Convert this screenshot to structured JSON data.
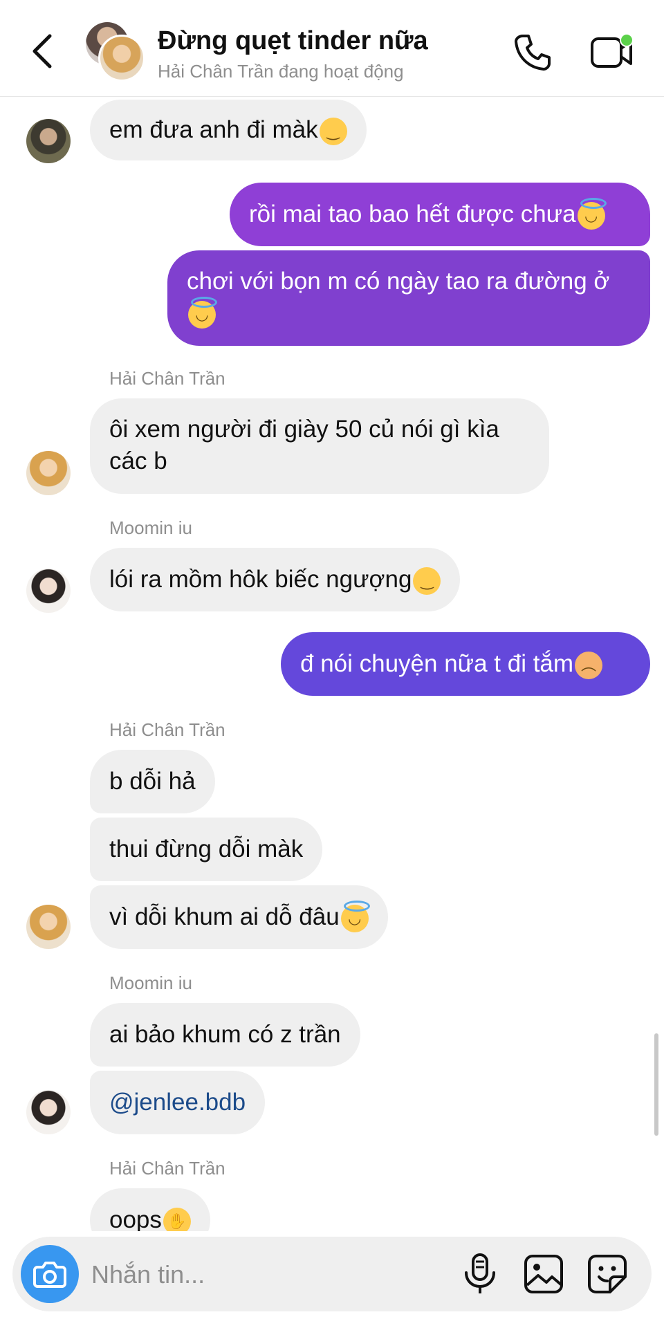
{
  "header": {
    "title": "Đừng quẹt tinder nữa",
    "subtitle": "Hải Chân Trần đang hoạt động",
    "icons": [
      "chevron-left-icon",
      "phone-icon",
      "video-call-icon"
    ]
  },
  "messages": [
    {
      "direction": "in",
      "sender": "",
      "text": "em đưa anh đi màk",
      "emoji": "😞"
    },
    {
      "direction": "out",
      "text": "rồi mai tao bao hết được chưa",
      "emoji": "😇"
    },
    {
      "direction": "out",
      "text": "chơi với bọn m có ngày tao ra đường ở",
      "emoji": "😇"
    },
    {
      "direction": "in",
      "sender": "Hải Chân Trần",
      "text_line1": "ôi xem người đi giày 50 củ nói gì kìa",
      "text_line2": "các b"
    },
    {
      "direction": "in",
      "sender": "Moomin iu",
      "text": "lói ra mồm hôk biếc ngượng",
      "emoji": "😞"
    },
    {
      "direction": "out",
      "text": "đ nói chuyện nữa t đi tắm",
      "emoji": "😠"
    },
    {
      "direction": "in",
      "sender": "Hải Chân Trần",
      "text": "b dỗi hả"
    },
    {
      "direction": "in",
      "text": "thui đừng dỗi màk"
    },
    {
      "direction": "in",
      "text": "vì dỗi khum ai dỗ đâu",
      "emoji": "😇"
    },
    {
      "direction": "in",
      "sender": "Moomin iu",
      "text": "ai bảo khum có z trần"
    },
    {
      "direction": "in",
      "text": "@jenlee.bdb"
    },
    {
      "direction": "in",
      "sender": "Hải Chân Trần",
      "text": "oops",
      "emoji": "🤭"
    }
  ],
  "composer": {
    "placeholder": "Nhắn tin...",
    "icons": [
      "camera-icon",
      "microphone-icon",
      "gallery-icon",
      "sticker-icon"
    ]
  },
  "colors": {
    "incoming_bubble": "#efefef",
    "outgoing_purple_top": "#9a3fd6",
    "outgoing_purple_mid": "#7f3fcf",
    "outgoing_blue": "#6448db",
    "camera_button": "#3897f0",
    "online_dot": "#5bd14a",
    "mention": "#1c4b8a"
  }
}
